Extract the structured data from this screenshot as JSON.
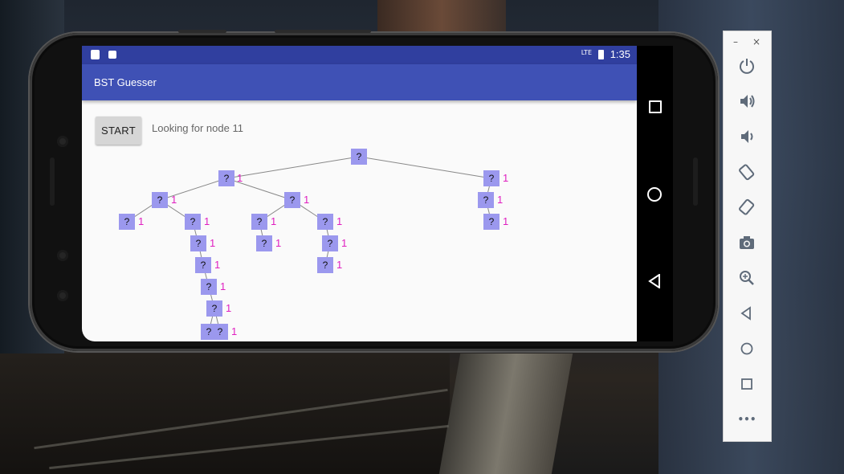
{
  "status_bar": {
    "time": "1:35",
    "network": "LTE",
    "left_icons": [
      "sd-card-icon",
      "a-badge-icon"
    ],
    "color": "#303f9f"
  },
  "app_bar": {
    "title": "BST Guesser",
    "color": "#3f51b5"
  },
  "controls": {
    "start_label": "START",
    "status_message": "Looking for node 11"
  },
  "tree": {
    "node_label": "?",
    "count_label": "1",
    "node_color": "#9b98ee",
    "count_color": "#e020c0"
  },
  "nav_bar": [
    "overview-icon",
    "home-icon",
    "back-icon"
  ],
  "emulator_panel": {
    "minimize": "–",
    "close": "×",
    "tools": [
      "power-icon",
      "volume-up-icon",
      "volume-down-icon",
      "rotate-left-icon",
      "rotate-right-icon",
      "camera-icon",
      "zoom-icon",
      "back-icon",
      "home-icon",
      "overview-icon",
      "more-icon"
    ],
    "more_label": "•••"
  }
}
